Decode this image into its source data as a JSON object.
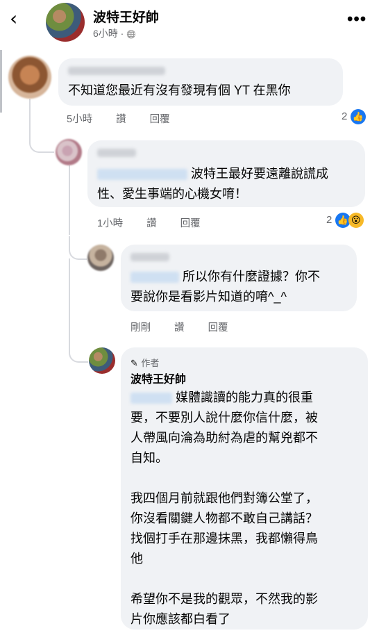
{
  "header": {
    "back_icon": "‹",
    "name": "波特王好帥",
    "time": "6小時 · ",
    "globe_icon": "🌐",
    "more_icon": "•••"
  },
  "comments": [
    {
      "text": "不知道您最近有沒有發現有個 YT 在黑你",
      "time": "5小時",
      "like": "讚",
      "reply": "回覆",
      "count": "2"
    },
    {
      "text_line1": "波特王最好要遠離說謊成",
      "text_line2": "性、愛生事端的心機女唷！",
      "time": "1小時",
      "like": "讚",
      "reply": "回覆",
      "count": "2"
    },
    {
      "text_line1": "所以你有什麼證據？你不",
      "text_line2": "要說你是看影片知道的唷^_^",
      "time": "剛剛",
      "like": "讚",
      "reply": "回覆"
    },
    {
      "badge": "作者",
      "name": "波特王好帥",
      "lines": [
        "媒體識讀的能力真的很重",
        "要，不要別人說什麼你信什麼，被",
        "人帶風向淪為助紂為虐的幫兇都不",
        "自知。",
        "",
        "我四個月前就跟他們對簿公堂了，",
        "你沒看關鍵人物都不敢自己講話？",
        "找個打手在那邊抹黑，我都懶得鳥",
        "他",
        "",
        "希望你不是我的觀眾，不然我的影",
        "片你應該都白看了"
      ]
    }
  ],
  "colors": {
    "bubble": "#f0f2f5",
    "like_blue": "#1877f2",
    "meta_gray": "#65676b"
  }
}
